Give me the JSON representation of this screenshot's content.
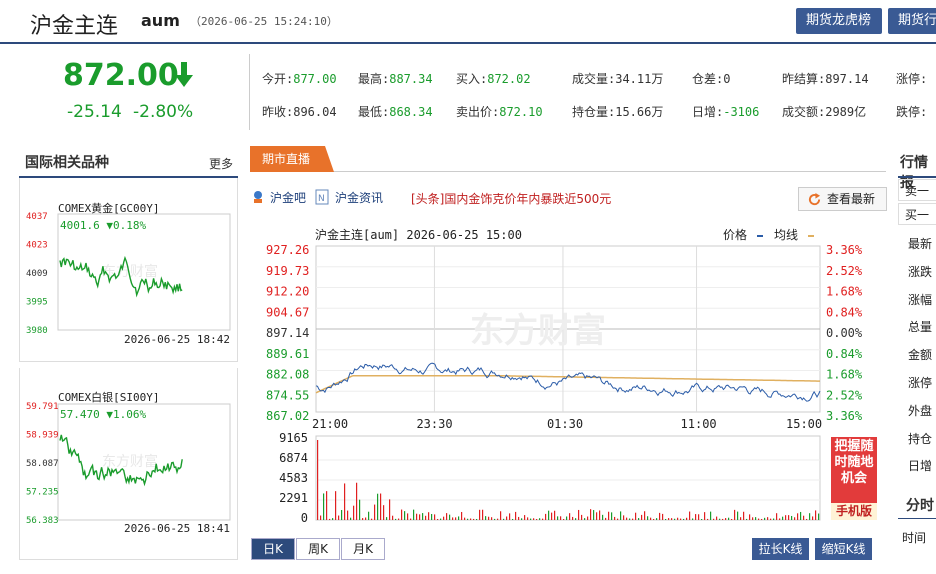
{
  "header": {
    "title": "沪金主连",
    "code": "aum",
    "datetime": "（2026-06-25 15:24:10）",
    "buttons": [
      "期货龙虎榜",
      "期货行"
    ]
  },
  "quote": {
    "price": "872.00",
    "change": "-25.14",
    "change_pct": "-2.80%",
    "stats_row1": [
      {
        "label": "今开:",
        "value": "877.00",
        "color": "green"
      },
      {
        "label": "最高:",
        "value": "887.34",
        "color": "green"
      },
      {
        "label": "买入:",
        "value": "872.02",
        "color": "green"
      },
      {
        "label": "成交量:",
        "value": "34.11万",
        "color": "black"
      },
      {
        "label": "仓差:",
        "value": "0",
        "color": "black"
      },
      {
        "label": "昨结算:",
        "value": "897.14",
        "color": "black"
      },
      {
        "label": "涨停:",
        "value": "",
        "color": "black"
      }
    ],
    "stats_row2": [
      {
        "label": "昨收:",
        "value": "896.04",
        "color": "black"
      },
      {
        "label": "最低:",
        "value": "868.34",
        "color": "green"
      },
      {
        "label": "卖出价:",
        "value": "872.10",
        "color": "green"
      },
      {
        "label": "持仓量:",
        "value": "15.66万",
        "color": "black"
      },
      {
        "label": "日增:",
        "value": "-3106",
        "color": "green"
      },
      {
        "label": "成交额:",
        "value": "2989亿",
        "color": "black"
      },
      {
        "label": "跌停:",
        "value": "",
        "color": "black"
      }
    ]
  },
  "left_panel": {
    "title": "国际相关品种",
    "more": "更多",
    "gold": {
      "name": "COMEX黄金[GC00Y]",
      "value": "4001.6 ▼0.18%",
      "yticks": [
        "4037",
        "4023",
        "4009",
        "3995",
        "3980"
      ],
      "date": "2026-06-25  18:42"
    },
    "silver": {
      "name": "COMEX白银[SI00Y]",
      "value": "57.470 ▼1.06%",
      "yticks": [
        "59.791",
        "58.939",
        "58.087",
        "57.235",
        "56.383"
      ],
      "date": "2026-06-25  18:41"
    }
  },
  "live": {
    "tab": "期市直播",
    "link1": "沪金吧",
    "link2": "沪金资讯",
    "news": "[头条]国内金饰克价年内暴跌近500元",
    "refresh": "查看最新"
  },
  "chart": {
    "title": "沪金主连[aum] 2026-06-25 15:00",
    "legend_price": "价格",
    "legend_avg": "均线",
    "watermark": "东方财富",
    "price_ticks": [
      "927.26",
      "919.73",
      "912.20",
      "904.67",
      "897.14",
      "889.61",
      "882.08",
      "874.55",
      "867.02"
    ],
    "pct_ticks": [
      "3.36%",
      "2.52%",
      "1.68%",
      "0.84%",
      "0.00%",
      "0.84%",
      "1.68%",
      "2.52%",
      "3.36%"
    ],
    "x_ticks": [
      "21:00",
      "23:30",
      "01:30",
      "11:00",
      "15:00"
    ],
    "vol_ticks": [
      "9165",
      "6874",
      "4583",
      "2291",
      "0"
    ],
    "colors": {
      "price": "#2b5ca8",
      "avg": "#e0b060",
      "up": "#e02020",
      "down": "#1a9c2c"
    }
  },
  "ad": {
    "text": "把握随时随地机会",
    "footer": "手机版"
  },
  "ktabs": [
    "日K",
    "周K",
    "月K"
  ],
  "kbuttons": [
    "拉长K线",
    "缩短K线"
  ],
  "right_panel": {
    "title": "行情报",
    "tabs": [
      "卖一",
      "买一"
    ],
    "items": [
      "最新",
      "涨跌",
      "涨幅",
      "总量",
      "金额",
      "涨停",
      "外盘",
      "持仓",
      "日增"
    ],
    "fenshi_title": "分时",
    "time_label": "时间"
  }
}
